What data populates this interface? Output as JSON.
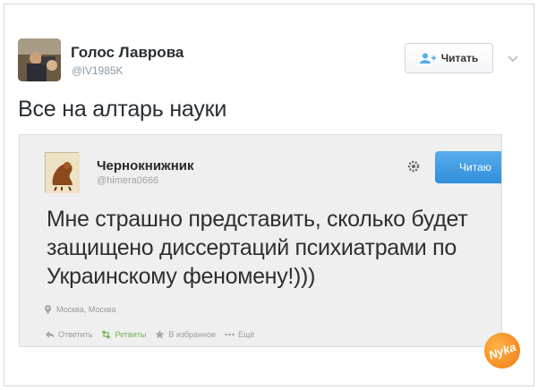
{
  "tweet": {
    "author_name": "Голос Лаврова",
    "author_handle": "@lV1985K",
    "follow_label": "Читать",
    "text": "Все на алтарь науки"
  },
  "embedded_tweet": {
    "author_name": "Чернокнижник",
    "author_handle": "@himera0666",
    "follow_label": "Читаю",
    "text": "Мне страшно представить, сколько будет защищено диссертаций психиатрами по Украинскому феномену!)))",
    "location": "Москва, Москва",
    "actions": {
      "reply": "Ответить",
      "retweet": "Ретвиты",
      "favorite": "В избранное",
      "more": "Ещё"
    }
  },
  "watermark_text": "Nyka",
  "colors": {
    "follow_blue": "#2f8fdb",
    "handle_gray": "#8899a6",
    "watermark_orange": "#f07a14"
  }
}
